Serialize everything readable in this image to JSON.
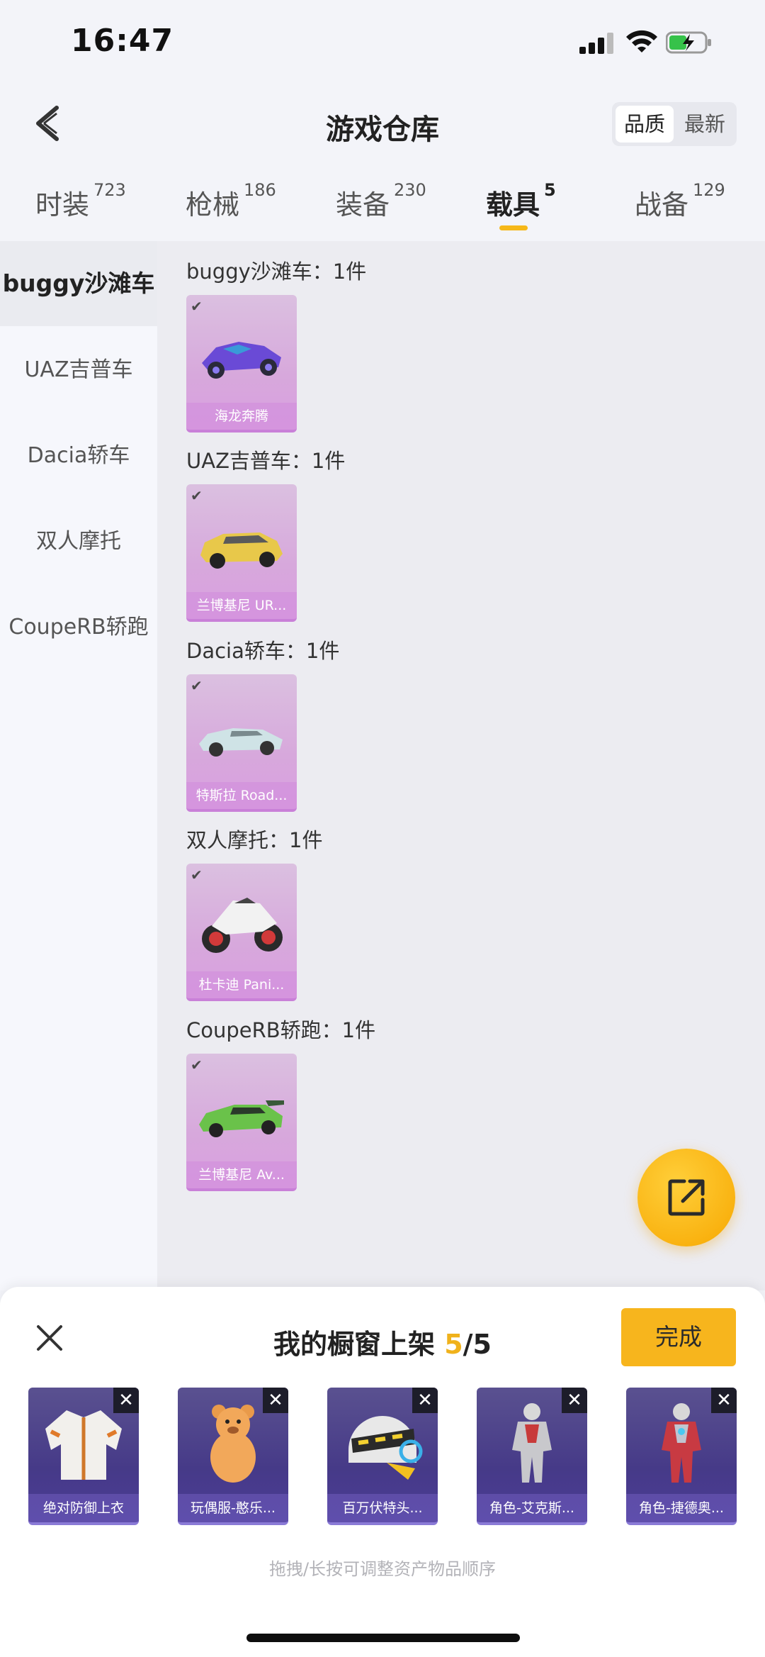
{
  "status": {
    "time": "16:47"
  },
  "header": {
    "title": "游戏仓库",
    "sort_options": [
      "品质",
      "最新"
    ],
    "active_sort": "品质"
  },
  "tabs": [
    {
      "label": "时装",
      "count": "723"
    },
    {
      "label": "枪械",
      "count": "186"
    },
    {
      "label": "装备",
      "count": "230"
    },
    {
      "label": "载具",
      "count": "5"
    },
    {
      "label": "战备",
      "count": "129"
    }
  ],
  "active_tab": "载具",
  "sidebar": {
    "items": [
      "buggy沙滩车",
      "UAZ吉普车",
      "Dacia轿车",
      "双人摩托",
      "CoupeRB轿跑"
    ],
    "active": "buggy沙滩车"
  },
  "groups": [
    {
      "title": "buggy沙滩车：1件",
      "item": "海龙奔腾",
      "icon": "purple-buggy"
    },
    {
      "title": "UAZ吉普车：1件",
      "item": "兰博基尼 UR...",
      "icon": "yellow-suv"
    },
    {
      "title": "Dacia轿车：1件",
      "item": "特斯拉 Road...",
      "icon": "silver-roadster"
    },
    {
      "title": "双人摩托：1件",
      "item": "杜卡迪 Pani...",
      "icon": "white-motorcycle"
    },
    {
      "title": "CoupeRB轿跑：1件",
      "item": "兰博基尼 Av...",
      "icon": "green-supercar"
    }
  ],
  "fab": {
    "icon": "share-icon"
  },
  "sheet": {
    "title_prefix": "我的橱窗上架 ",
    "count": "5",
    "total": "/5",
    "done_label": "完成",
    "hint": "拖拽/长按可调整资产物品顺序",
    "slots": [
      {
        "name": "绝对防御上衣",
        "icon": "jacket"
      },
      {
        "name": "玩偶服-憨乐...",
        "icon": "bear-costume"
      },
      {
        "name": "百万伏特头...",
        "icon": "helmet"
      },
      {
        "name": "角色-艾克斯...",
        "icon": "hero-silver"
      },
      {
        "name": "角色-捷德奥...",
        "icon": "hero-red"
      }
    ]
  },
  "colors": {
    "accent": "#f7b51d",
    "card_purple": "#d7a8dc",
    "slot_indigo": "#463a88"
  }
}
